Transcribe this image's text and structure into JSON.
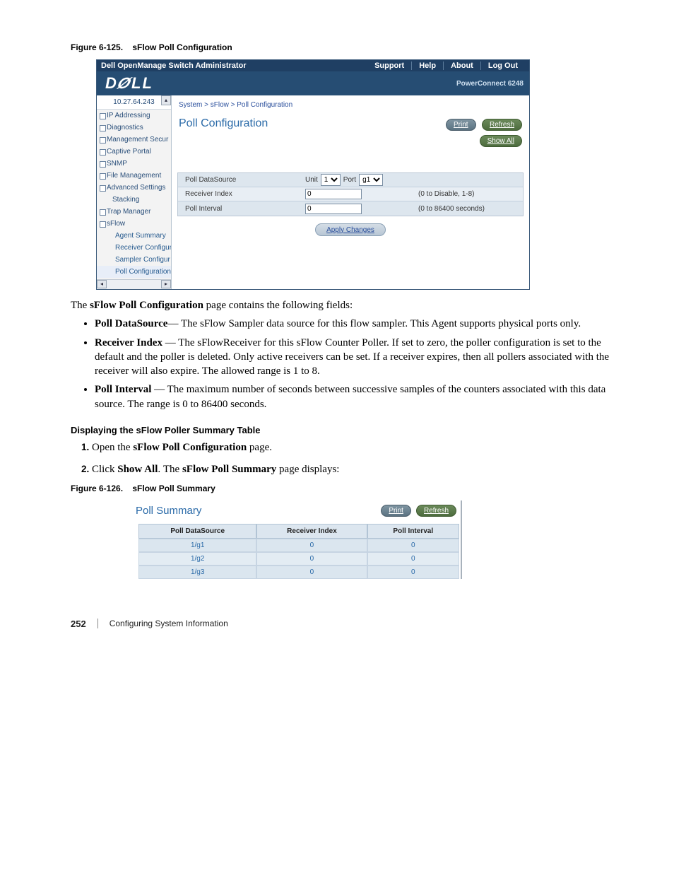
{
  "figure1": {
    "number": "Figure 6-125.",
    "title": "sFlow Poll Configuration"
  },
  "figure2": {
    "number": "Figure 6-126.",
    "title": "sFlow Poll Summary"
  },
  "s1": {
    "window_title": "Dell OpenManage Switch Administrator",
    "titlelinks": {
      "support": "Support",
      "help": "Help",
      "about": "About",
      "logout": "Log Out"
    },
    "logo": "DELL",
    "model": "PowerConnect 6248",
    "ip": "10.27.64.243",
    "breadcrumb": "System > sFlow > Poll Configuration",
    "section_title": "Poll Configuration",
    "btn_print": "Print",
    "btn_refresh": "Refresh",
    "btn_showall": "Show All",
    "nav": {
      "ip": "IP Addressing",
      "diag": "Diagnostics",
      "mgmt": "Management Secur",
      "captive": "Captive Portal",
      "snmp": "SNMP",
      "file": "File Management",
      "adv": "Advanced Settings",
      "stack": "Stacking",
      "trap": "Trap Manager",
      "sflow": "sFlow",
      "agent": "Agent Summary",
      "recv": "Receiver Configur",
      "samp": "Sampler Configur",
      "poll": "Poll Configuration"
    },
    "rows": {
      "r1_label": "Poll DataSource",
      "r1_unit_lbl": "Unit",
      "r1_unit_val": "1",
      "r1_port_lbl": "Port",
      "r1_port_val": "g1",
      "r2_label": "Receiver Index",
      "r2_val": "0",
      "r2_hint": "(0 to Disable, 1-8)",
      "r3_label": "Poll Interval",
      "r3_val": "0",
      "r3_hint": "(0 to 86400 seconds)"
    },
    "apply": "Apply Changes"
  },
  "intro": "The sFlow Poll Configuration page contains the following fields:",
  "bullets": {
    "b1_term": "Poll DataSource",
    "b1_text": "— The sFlow Sampler data source for this flow sampler. This Agent supports physical ports only.",
    "b2_term": "Receiver Index",
    "b2_text": " — The sFlowReceiver for this sFlow Counter Poller. If set to zero, the poller configuration is set to the default and the poller is deleted. Only active receivers can be set. If a receiver expires, then all pollers associated with the receiver will also expire. The allowed range is 1 to 8.",
    "b3_term": "Poll Interval",
    "b3_text": " — The maximum number of seconds between successive samples of the counters associated with this data source. The range is 0 to 86400 seconds."
  },
  "sub1": "Displaying the sFlow Poller Summary Table",
  "steps": {
    "s1a": "Open the ",
    "s1b": "sFlow Poll Configuration",
    "s1c": " page.",
    "s2a": "Click ",
    "s2b": "Show All",
    "s2c": ".",
    "after": "The sFlow Poll Summary page displays:",
    "after_b": "sFlow Poll Summary"
  },
  "s2": {
    "title": "Poll Summary",
    "btn_print": "Print",
    "btn_refresh": "Refresh",
    "th1": "Poll DataSource",
    "th2": "Receiver Index",
    "th3": "Poll Interval",
    "rows": [
      {
        "ds": "1/g1",
        "ri": "0",
        "pi": "0"
      },
      {
        "ds": "1/g2",
        "ri": "0",
        "pi": "0"
      },
      {
        "ds": "1/g3",
        "ri": "0",
        "pi": "0"
      }
    ]
  },
  "footer": {
    "page": "252",
    "chapter": "Configuring System Information"
  }
}
